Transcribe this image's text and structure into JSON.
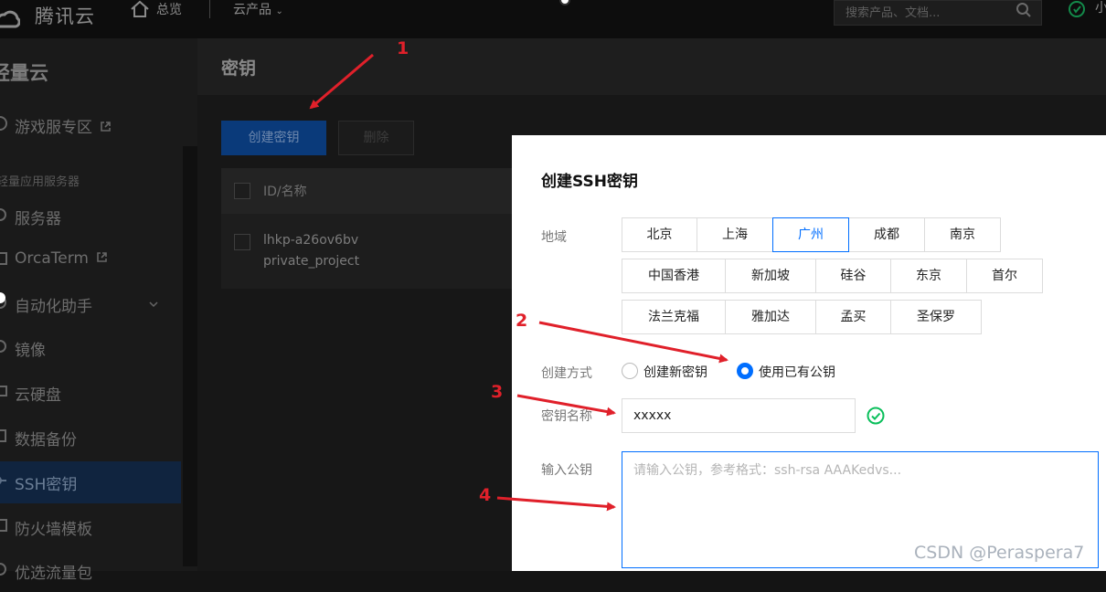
{
  "topbar": {
    "brand": "腾讯云",
    "home_label": "总览",
    "products_label": "云产品",
    "search_placeholder": "搜索产品、文档...",
    "user_label": "小"
  },
  "sidebar": {
    "title": "轻量云",
    "group_label": "轻量应用服务器",
    "items": [
      {
        "label": "游戏服专区"
      },
      {
        "label": "服务器"
      },
      {
        "label": "OrcaTerm"
      },
      {
        "label": "自动化助手"
      },
      {
        "label": "镜像"
      },
      {
        "label": "云硬盘"
      },
      {
        "label": "数据备份"
      },
      {
        "label": "SSH密钥"
      },
      {
        "label": "防火墙模板"
      },
      {
        "label": "优选流量包"
      }
    ],
    "active_item": "SSH密钥"
  },
  "main": {
    "title": "密钥",
    "create_button": "创建密钥",
    "delete_button": "删除",
    "table": {
      "header": "ID/名称",
      "rows": [
        {
          "id": "lhkp-a26ov6bv",
          "name": "private_project"
        }
      ]
    }
  },
  "modal": {
    "title": "创建SSH密钥",
    "region_label": "地域",
    "regions_row1": [
      "北京",
      "上海",
      "广州",
      "成都",
      "南京"
    ],
    "regions_row2": [
      "中国香港",
      "新加坡",
      "硅谷",
      "东京",
      "首尔"
    ],
    "regions_row3": [
      "法兰克福",
      "雅加达",
      "孟买",
      "圣保罗"
    ],
    "selected_region": "广州",
    "method_label": "创建方式",
    "method_new": "创建新密钥",
    "method_existing": "使用已有公钥",
    "selected_method": "使用已有公钥",
    "name_label": "密钥名称",
    "name_value": "xxxxx",
    "pubkey_label": "输入公钥",
    "pubkey_placeholder": "请输入公钥，参考格式：ssh-rsa AAAKedvs..."
  },
  "annotations": {
    "step1": "1",
    "step2": "2",
    "step3": "3",
    "step4": "4",
    "color": "#e0202a"
  },
  "watermark": "CSDN @Peraspera7",
  "colors": {
    "accent": "#006eff",
    "success": "#0abf5b"
  }
}
